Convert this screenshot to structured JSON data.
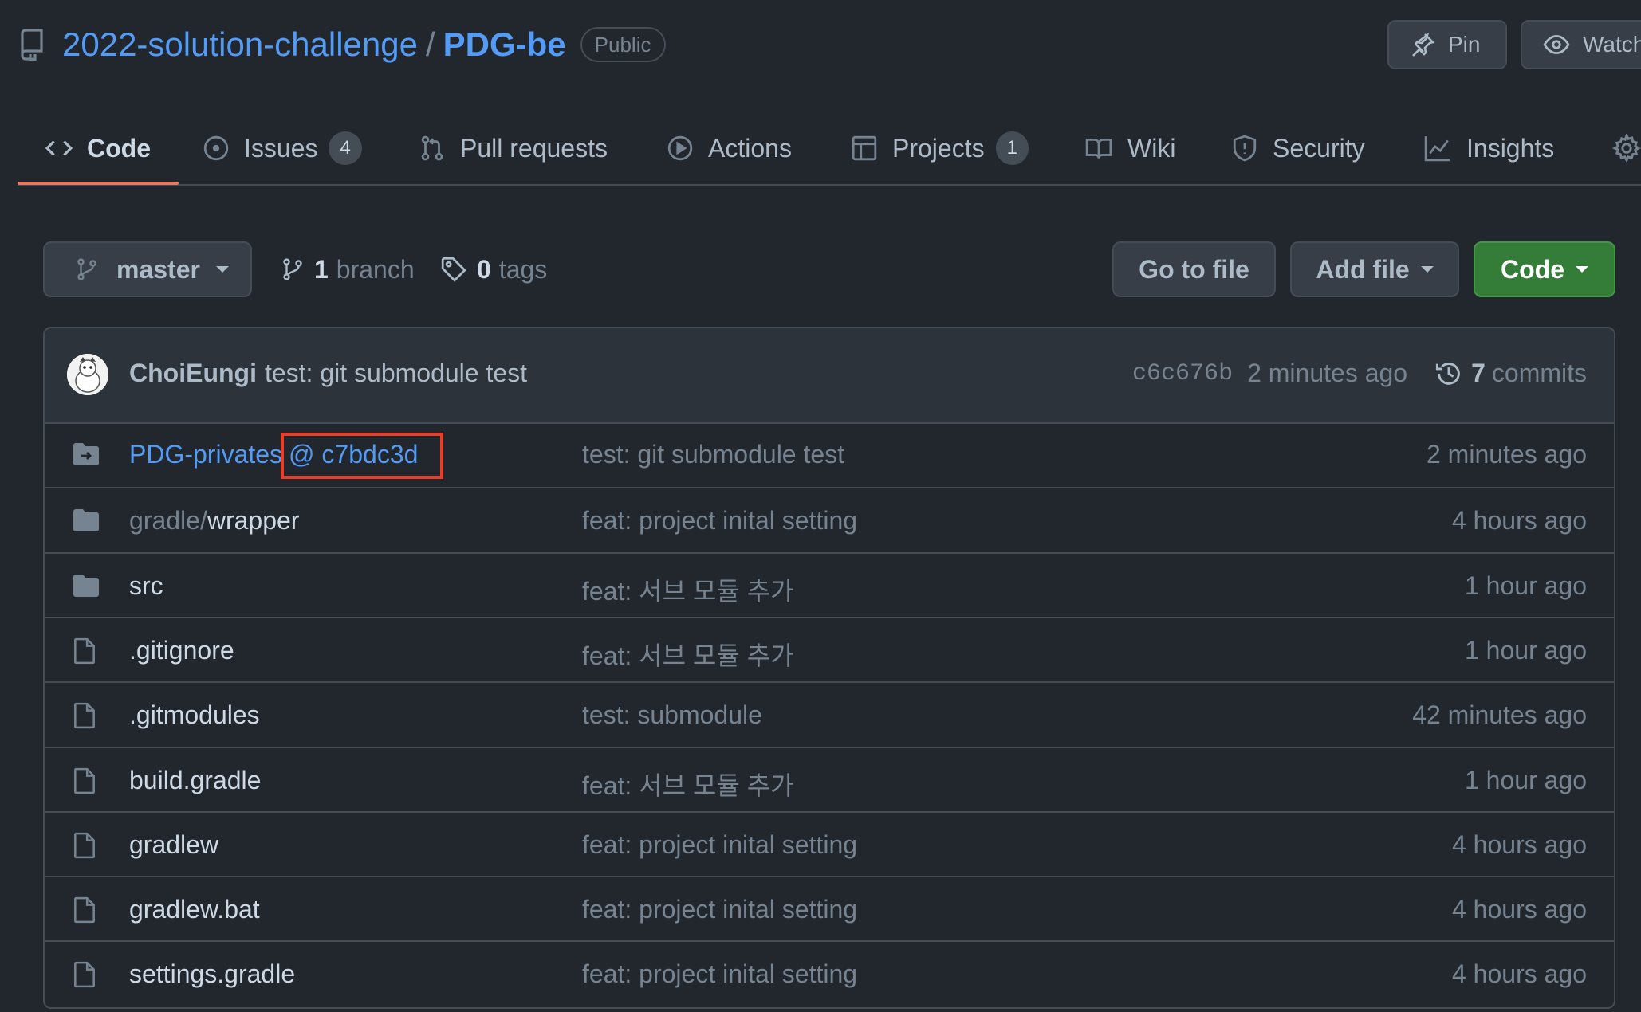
{
  "repo": {
    "owner": "2022-solution-challenge",
    "separator": "/",
    "name": "PDG-be",
    "visibility": "Public"
  },
  "header_buttons": {
    "pin": "Pin",
    "watch": "Watch"
  },
  "tabs": [
    {
      "label": "Code",
      "icon": "code-icon",
      "selected": true
    },
    {
      "label": "Issues",
      "icon": "issue-icon",
      "count": "4"
    },
    {
      "label": "Pull requests",
      "icon": "pull-request-icon"
    },
    {
      "label": "Actions",
      "icon": "play-icon"
    },
    {
      "label": "Projects",
      "icon": "project-icon",
      "count": "1"
    },
    {
      "label": "Wiki",
      "icon": "book-icon"
    },
    {
      "label": "Security",
      "icon": "shield-icon"
    },
    {
      "label": "Insights",
      "icon": "graph-icon"
    },
    {
      "label": "",
      "icon": "gear-icon"
    }
  ],
  "branch_bar": {
    "branch": "master",
    "branches_count": "1",
    "branches_label": "branch",
    "tags_count": "0",
    "tags_label": "tags",
    "go_to_file": "Go to file",
    "add_file": "Add file",
    "code": "Code"
  },
  "latest_commit": {
    "author": "ChoiEungi",
    "message": "test: git submodule test",
    "sha": "c6c676b",
    "time": "2 minutes ago",
    "commits_count": "7",
    "commits_label": "commits"
  },
  "files": [
    {
      "type": "submodule",
      "name": "PDG-privates",
      "sub_ref": "@ c7bdc3d",
      "message": "test: git submodule test",
      "age": "2 minutes ago"
    },
    {
      "type": "dir",
      "prefix": "gradle/",
      "name": "wrapper",
      "message": "feat: project inital setting",
      "age": "4 hours ago"
    },
    {
      "type": "dir",
      "name": "src",
      "message": "feat: 서브 모듈 추가",
      "age": "1 hour ago"
    },
    {
      "type": "file",
      "name": ".gitignore",
      "message": "feat: 서브 모듈 추가",
      "age": "1 hour ago"
    },
    {
      "type": "file",
      "name": ".gitmodules",
      "message": "test: submodule",
      "age": "42 minutes ago"
    },
    {
      "type": "file",
      "name": "build.gradle",
      "message": "feat: 서브 모듈 추가",
      "age": "1 hour ago"
    },
    {
      "type": "file",
      "name": "gradlew",
      "message": "feat: project inital setting",
      "age": "4 hours ago"
    },
    {
      "type": "file",
      "name": "gradlew.bat",
      "message": "feat: project inital setting",
      "age": "4 hours ago"
    },
    {
      "type": "file",
      "name": "settings.gradle",
      "message": "feat: project inital setting",
      "age": "4 hours ago"
    }
  ],
  "colors": {
    "background": "#22272e",
    "link": "#539bf5",
    "accent_underline": "#ec775c",
    "primary_button": "#347d39",
    "highlight_box": "#e5402b"
  }
}
